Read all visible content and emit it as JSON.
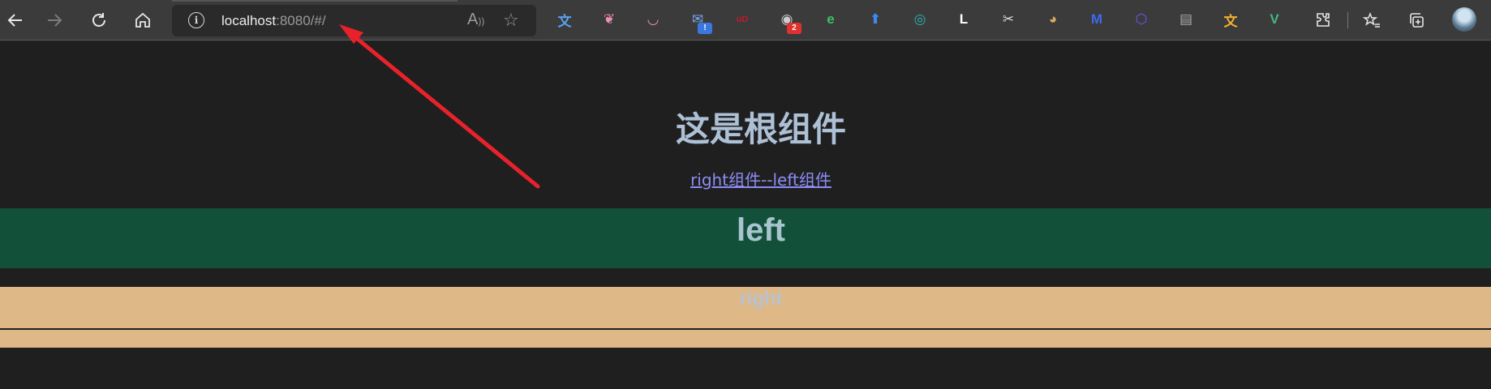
{
  "browser": {
    "url_host": "localhost",
    "url_rest": ":8080/#/",
    "read_aloud_icon": "read-aloud-icon",
    "favorite_icon": "add-favorite-icon"
  },
  "extensions": [
    {
      "name": "translate-extension-icon",
      "glyph": "文",
      "color": "#5aa0f0"
    },
    {
      "name": "butterfly-extension-icon",
      "glyph": "❦",
      "color": "#f08cb8"
    },
    {
      "name": "cat-extension-icon",
      "glyph": "◡",
      "color": "#f08cb8"
    },
    {
      "name": "mail-extension-icon",
      "glyph": "✉",
      "color": "#7aa8f0",
      "badge": "!"
    },
    {
      "name": "ublock-extension-icon",
      "glyph": "uD",
      "color": "#c0192c"
    },
    {
      "name": "mask-extension-icon",
      "glyph": "◉",
      "color": "#cccccc",
      "badge": "2"
    },
    {
      "name": "ie-tab-extension-icon",
      "glyph": "e",
      "color": "#3cc06a"
    },
    {
      "name": "cloud-upload-extension-icon",
      "glyph": "⬆",
      "color": "#3a8af0"
    },
    {
      "name": "circle-extension-icon",
      "glyph": "◎",
      "color": "#2bb0b0"
    },
    {
      "name": "lingq-extension-icon",
      "glyph": "L",
      "color": "#ffffff"
    },
    {
      "name": "scissors-extension-icon",
      "glyph": "✂",
      "color": "#dddddd"
    },
    {
      "name": "owl-extension-icon",
      "glyph": "◕",
      "color": "#d9a860"
    },
    {
      "name": "magic-extension-icon",
      "glyph": "M",
      "color": "#3a6af0"
    },
    {
      "name": "cube-extension-icon",
      "glyph": "⬡",
      "color": "#6a5af0"
    },
    {
      "name": "reader-extension-icon",
      "glyph": "▤",
      "color": "#aaaaaa"
    },
    {
      "name": "translator-extension-icon",
      "glyph": "文",
      "color": "#f0b030"
    },
    {
      "name": "vue-devtools-extension-icon",
      "glyph": "V",
      "color": "#41b883"
    }
  ],
  "toolbar_right": {
    "extensions_icon": "puzzle-icon",
    "favorites_icon": "favorites-icon",
    "collections_icon": "collections-icon"
  },
  "page": {
    "title": "这是根组件",
    "link": "right组件--left组件",
    "left_heading": "left",
    "right_heading": "right"
  },
  "colors": {
    "background": "#1f1f1f",
    "left_box": "#12503a",
    "right_box": "#deb887",
    "link": "#8c8cf5",
    "annotation_arrow": "#e8222b"
  }
}
